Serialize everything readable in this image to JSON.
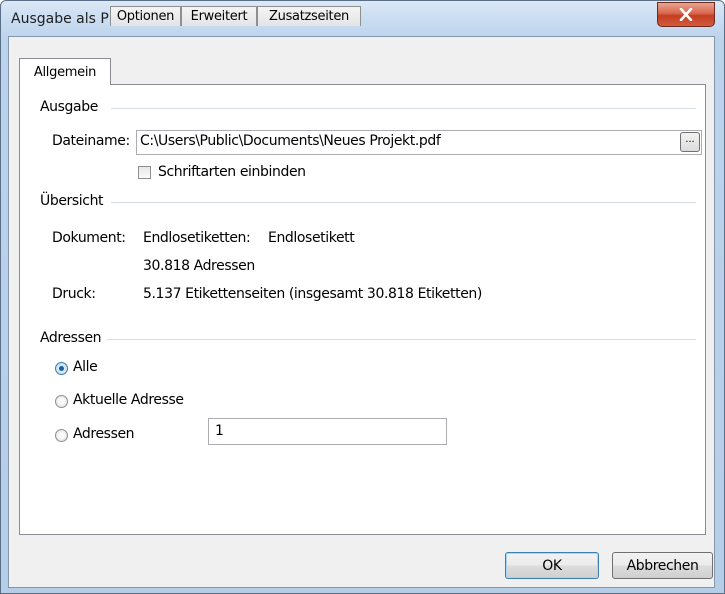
{
  "window": {
    "title": "Ausgabe als PDF-Datei"
  },
  "tabs": [
    {
      "label": "Allgemein",
      "active": true
    },
    {
      "label": "Optionen",
      "active": false
    },
    {
      "label": "Erweitert",
      "active": false
    },
    {
      "label": "Zusatzseiten",
      "active": false
    }
  ],
  "ausgabe": {
    "group_label": "Ausgabe",
    "filename_label": "Dateiname:",
    "filename_value": "C:\\Users\\Public\\Documents\\Neues Projekt.pdf",
    "browse_label": "...",
    "embed_fonts_label": "Schriftarten einbinden",
    "embed_fonts_checked": false
  },
  "uebersicht": {
    "group_label": "Übersicht",
    "dokument_label": "Dokument:",
    "dokument_type": "Endlosetiketten:",
    "dokument_name": "Endlosetikett",
    "dokument_count": "30.818 Adressen",
    "druck_label": "Druck:",
    "druck_value": "5.137 Etikettenseiten (insgesamt 30.818 Etiketten)"
  },
  "adressen": {
    "group_label": "Adressen",
    "options": [
      {
        "label": "Alle",
        "selected": true
      },
      {
        "label": "Aktuelle Adresse",
        "selected": false
      },
      {
        "label": "Adressen",
        "selected": false
      }
    ],
    "range_value": "1"
  },
  "buttons": {
    "ok_label": "OK",
    "cancel_label": "Abbrechen"
  }
}
